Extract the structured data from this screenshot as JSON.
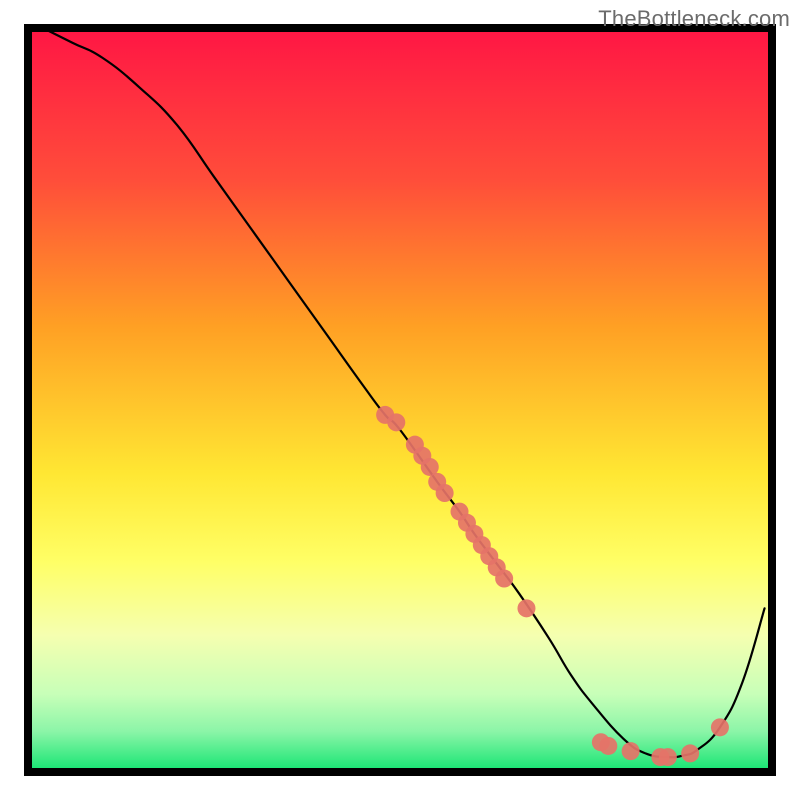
{
  "watermark": "TheBottleneck.com",
  "chart_data": {
    "type": "line",
    "title": "",
    "xlabel": "",
    "ylabel": "",
    "xlim": [
      0,
      100
    ],
    "ylim": [
      0,
      100
    ],
    "grid": false,
    "background_gradient": {
      "stops": [
        {
          "offset": 0.0,
          "color": "#ff1744"
        },
        {
          "offset": 0.2,
          "color": "#ff4d3a"
        },
        {
          "offset": 0.4,
          "color": "#ffa024"
        },
        {
          "offset": 0.6,
          "color": "#ffe733"
        },
        {
          "offset": 0.72,
          "color": "#ffff66"
        },
        {
          "offset": 0.82,
          "color": "#f5ffb0"
        },
        {
          "offset": 0.9,
          "color": "#c7ffb8"
        },
        {
          "offset": 0.95,
          "color": "#8cf5a8"
        },
        {
          "offset": 1.0,
          "color": "#1de676"
        }
      ]
    },
    "series": [
      {
        "name": "curve",
        "color": "#000000",
        "stroke_width": 2.2,
        "x": [
          2,
          6,
          10,
          15,
          20,
          25,
          30,
          35,
          40,
          45,
          48,
          50,
          55,
          58,
          60,
          63,
          66,
          70,
          73,
          76,
          80,
          83,
          86,
          88,
          90,
          93,
          96,
          99
        ],
        "y": [
          100,
          98,
          96,
          92,
          87,
          80,
          73,
          66,
          59,
          52,
          48,
          46,
          39,
          35,
          32,
          28,
          24,
          18,
          13,
          9,
          4.5,
          2.5,
          2,
          2.2,
          3,
          6,
          12,
          22
        ]
      }
    ],
    "scatter": [
      {
        "name": "points-on-curve",
        "color": "#e57368",
        "radius": 9,
        "points": [
          {
            "x": 48,
            "y": 48
          },
          {
            "x": 49.5,
            "y": 47
          },
          {
            "x": 52,
            "y": 44
          },
          {
            "x": 53,
            "y": 42.5
          },
          {
            "x": 54,
            "y": 41
          },
          {
            "x": 55,
            "y": 39
          },
          {
            "x": 56,
            "y": 37.5
          },
          {
            "x": 58,
            "y": 35
          },
          {
            "x": 59,
            "y": 33.5
          },
          {
            "x": 60,
            "y": 32
          },
          {
            "x": 61,
            "y": 30.5
          },
          {
            "x": 62,
            "y": 29
          },
          {
            "x": 63,
            "y": 27.5
          },
          {
            "x": 64,
            "y": 26
          },
          {
            "x": 67,
            "y": 22
          },
          {
            "x": 77,
            "y": 4
          },
          {
            "x": 78,
            "y": 3.5
          },
          {
            "x": 81,
            "y": 2.8
          },
          {
            "x": 85,
            "y": 2
          },
          {
            "x": 86,
            "y": 2
          },
          {
            "x": 89,
            "y": 2.5
          },
          {
            "x": 93,
            "y": 6
          }
        ]
      }
    ]
  }
}
